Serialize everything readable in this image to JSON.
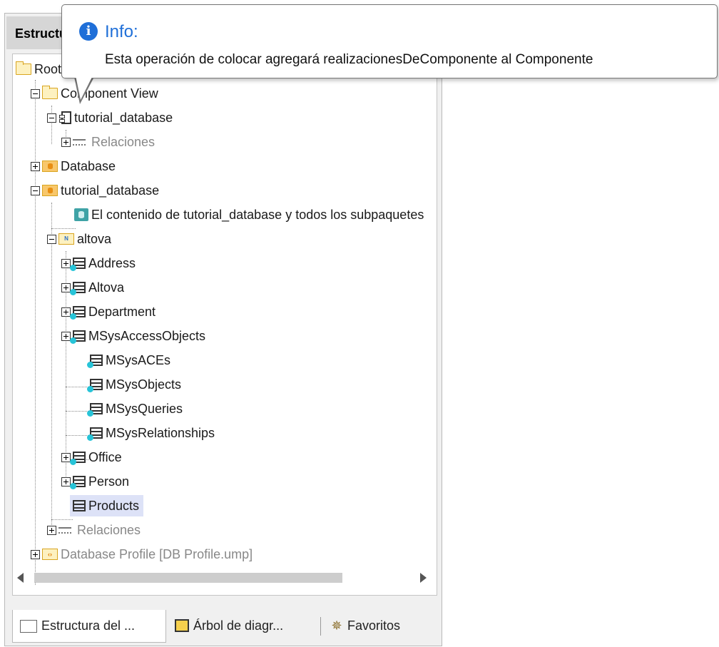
{
  "panel": {
    "title": "Estructura del modelo"
  },
  "tree": [
    {
      "label": "Root",
      "icon": "folder-icon",
      "gray": false
    },
    {
      "label": "Component View",
      "icon": "folder-icon",
      "gray": false
    },
    {
      "label": "tutorial_database",
      "icon": "component-icon",
      "gray": false
    },
    {
      "label": "Relaciones",
      "icon": "relations-icon",
      "gray": true
    },
    {
      "label": "Database",
      "icon": "database-folder-icon",
      "gray": false
    },
    {
      "label": "tutorial_database",
      "icon": "database-folder-icon",
      "gray": false
    },
    {
      "label": "El contenido de tutorial_database y todos los subpaquetes",
      "icon": "database-icon",
      "gray": false
    },
    {
      "label": "altova",
      "icon": "namespace-folder-icon",
      "gray": false
    },
    {
      "label": "Address",
      "icon": "table-icon",
      "gray": false
    },
    {
      "label": "Altova",
      "icon": "table-icon",
      "gray": false
    },
    {
      "label": "Department",
      "icon": "table-icon",
      "gray": false
    },
    {
      "label": "MSysAccessObjects",
      "icon": "table-icon",
      "gray": false
    },
    {
      "label": "MSysACEs",
      "icon": "table-icon",
      "gray": false
    },
    {
      "label": "MSysObjects",
      "icon": "table-icon",
      "gray": false
    },
    {
      "label": "MSysQueries",
      "icon": "table-icon",
      "gray": false
    },
    {
      "label": "MSysRelationships",
      "icon": "table-icon",
      "gray": false
    },
    {
      "label": "Office",
      "icon": "table-icon",
      "gray": false
    },
    {
      "label": "Person",
      "icon": "table-icon",
      "gray": false
    },
    {
      "label": "Products",
      "icon": "table-icon",
      "gray": false,
      "selected": true
    },
    {
      "label": "Relaciones",
      "icon": "relations-icon",
      "gray": true
    },
    {
      "label": "Database Profile [DB Profile.ump]",
      "icon": "profile-folder-icon",
      "gray": true
    }
  ],
  "tabs": [
    {
      "label": "Estructura del ...",
      "icon": "folder-icon",
      "active": true
    },
    {
      "label": "Árbol de diagr...",
      "icon": "diagram-icon",
      "active": false
    },
    {
      "label": "Favoritos",
      "icon": "favorites-icon",
      "active": false
    }
  ],
  "tooltip": {
    "title": "Info:",
    "message": "Esta operación de colocar agregará realizacionesDeComponente al Componente",
    "icon": "info-icon",
    "accent": "#1f6fd8"
  }
}
